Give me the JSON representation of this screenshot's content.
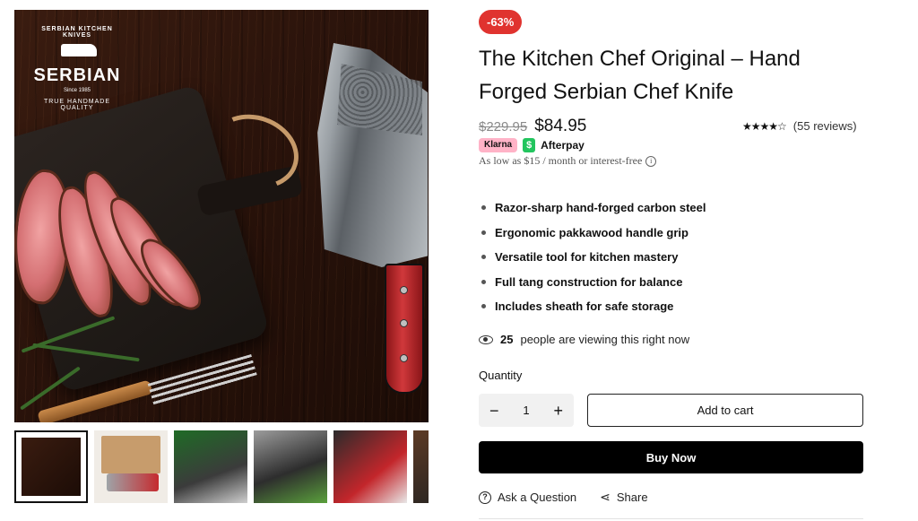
{
  "gallery": {
    "logo": {
      "arc_top": "SERBIAN KITCHEN KNIVES",
      "brand": "SERBIAN",
      "subtitle": "Since 1985",
      "arc_bottom": "TRUE HANDMADE QUALITY"
    },
    "thumbnails": [
      "thumbnail-1",
      "thumbnail-2",
      "thumbnail-3",
      "thumbnail-4",
      "thumbnail-5",
      "thumbnail-6"
    ],
    "active_thumbnail": 0
  },
  "product": {
    "discount_badge": "-63%",
    "title": "The Kitchen Chef Original – Hand Forged Serbian Chef Knife",
    "price_old": "$229.95",
    "price_new": "$84.95",
    "stars": "★★★★☆",
    "rating_value": 4.5,
    "reviews": "(55 reviews)",
    "klarna_label": "Klarna",
    "afterpay_icon": "$",
    "afterpay_label": "Afterpay",
    "installment_text": "As low as $15 / month or interest-free",
    "info_icon": "i",
    "features": [
      "Razor-sharp hand-forged carbon steel",
      "Ergonomic pakkawood handle grip",
      "Versatile tool for kitchen mastery",
      "Full tang construction for balance",
      "Includes sheath for safe storage"
    ],
    "viewers_count": "25",
    "viewers_text": "people are viewing this right now",
    "quantity_label": "Quantity",
    "quantity_value": "1",
    "minus": "−",
    "plus": "+",
    "add_to_cart": "Add to cart",
    "buy_now": "Buy Now",
    "ask_question": "Ask a Question",
    "question_icon": "?",
    "share": "Share",
    "share_icon": "⋖"
  },
  "colors": {
    "badge": "#e0332f",
    "buy_now_bg": "#000000",
    "klarna": "#ffb3c7",
    "afterpay": "#22c55e"
  }
}
